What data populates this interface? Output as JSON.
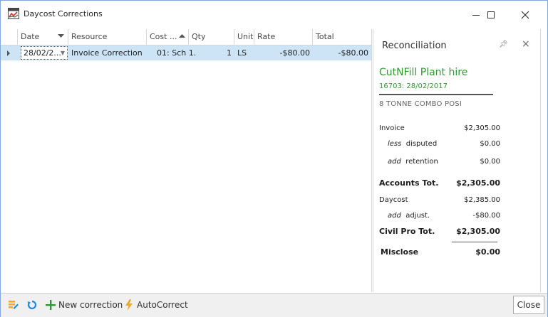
{
  "window": {
    "title": "Daycost Corrections"
  },
  "grid": {
    "columns": [
      {
        "label": "Date"
      },
      {
        "label": "Resource"
      },
      {
        "label": "Cost ..."
      },
      {
        "label": "Qty"
      },
      {
        "label": "Unit"
      },
      {
        "label": "Rate"
      },
      {
        "label": "Total"
      }
    ],
    "rows": [
      {
        "date": "28/02/2...",
        "resource": "Invoice Correction",
        "cost": "01: Sch 1...",
        "qty": "1",
        "unit": "LS",
        "rate": "-$80.00",
        "total": "-$80.00"
      }
    ]
  },
  "panel": {
    "title": "Reconciliation",
    "supplier": "CutNFill Plant hire",
    "reference": "16703: 28/02/2017",
    "plant": "8 TONNE COMBO POSI",
    "lines": {
      "invoice": {
        "label": "Invoice",
        "value": "$2,305.00"
      },
      "disputed": {
        "prefix": "less",
        "label": "disputed",
        "value": "$0.00"
      },
      "retention": {
        "prefix": "add",
        "label": "retention",
        "value": "$0.00"
      },
      "accounts_total": {
        "label": "Accounts Tot.",
        "value": "$2,305.00"
      },
      "daycost": {
        "label": "Daycost",
        "value": "$2,385.00"
      },
      "adjust": {
        "prefix": "add",
        "label": "adjust.",
        "value": "-$80.00"
      },
      "civil_total": {
        "label": "Civil Pro Tot.",
        "value": "$2,305.00"
      },
      "misclose": {
        "label": "Misclose",
        "value": "$0.00"
      }
    }
  },
  "toolbar": {
    "new_correction": "New correction",
    "autocorrect": "AutoCorrect",
    "close": "Close"
  },
  "colors": {
    "accent_green": "#2f9a2f",
    "selection": "#cde4f7",
    "toolbar_icon_blue": "#1e88e5",
    "toolbar_icon_orange": "#f5a623"
  }
}
